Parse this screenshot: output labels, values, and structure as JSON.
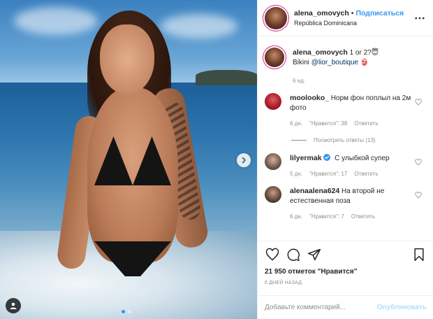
{
  "post": {
    "username": "alena_omovych",
    "follow_label": "Подписаться",
    "separator": "•",
    "location": "República Dominicana"
  },
  "caption": {
    "username": "alena_omovych",
    "line1": "1 or 2?😇",
    "line2_prefix": "Bikini",
    "line2_tag": "@lior_boutique",
    "line2_suffix": "👙",
    "time": "6 нд."
  },
  "comments": [
    {
      "username": "moolooko_",
      "text": "Норм фон поплыл на 2м фото",
      "time": "6 дн.",
      "likes": "\"Нравится\": 38",
      "reply": "Ответить",
      "view_replies": "Посмотреть ответы (13)"
    },
    {
      "username": "lilyermak",
      "text": "С улыбкой супер",
      "time": "5 дн.",
      "likes": "\"Нравится\": 17",
      "reply": "Ответить"
    },
    {
      "username": "alenaalena624",
      "text": "На второй не естественная поза",
      "time": "6 дн.",
      "likes": "\"Нравится\": 7",
      "reply": "Ответить"
    }
  ],
  "footer": {
    "likes_count": "21 950 отметок \"Нравится\"",
    "date": "6 ДНЕЙ НАЗАД",
    "comment_placeholder": "Добавьте комментарий...",
    "publish_label": "Опубликовать"
  },
  "carousel": {
    "total_slides": 2,
    "active_slide": 1
  },
  "colors": {
    "accent": "#3897f0",
    "muted": "#8e8e8e",
    "publish_disabled": "#b2dffc"
  }
}
